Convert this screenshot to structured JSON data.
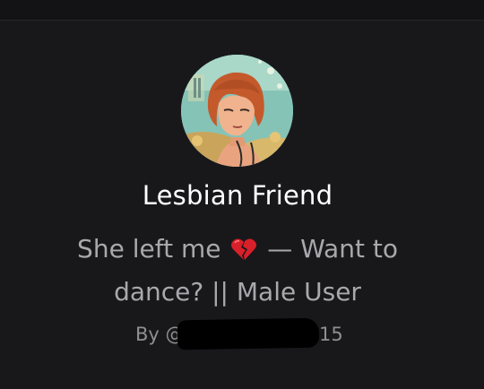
{
  "character": {
    "name": "Lesbian Friend",
    "tagline_before": "She left me",
    "tagline_after": "— Want to dance? || Male User",
    "author_prefix": "By @C",
    "author_suffix": "15"
  },
  "icons": {
    "broken_heart": "broken-heart-icon"
  },
  "colors": {
    "background": "#18181b",
    "name": "#ffffff",
    "tagline": "#a8a8ad",
    "author": "#8e8e93",
    "heart": "#d9202a"
  }
}
